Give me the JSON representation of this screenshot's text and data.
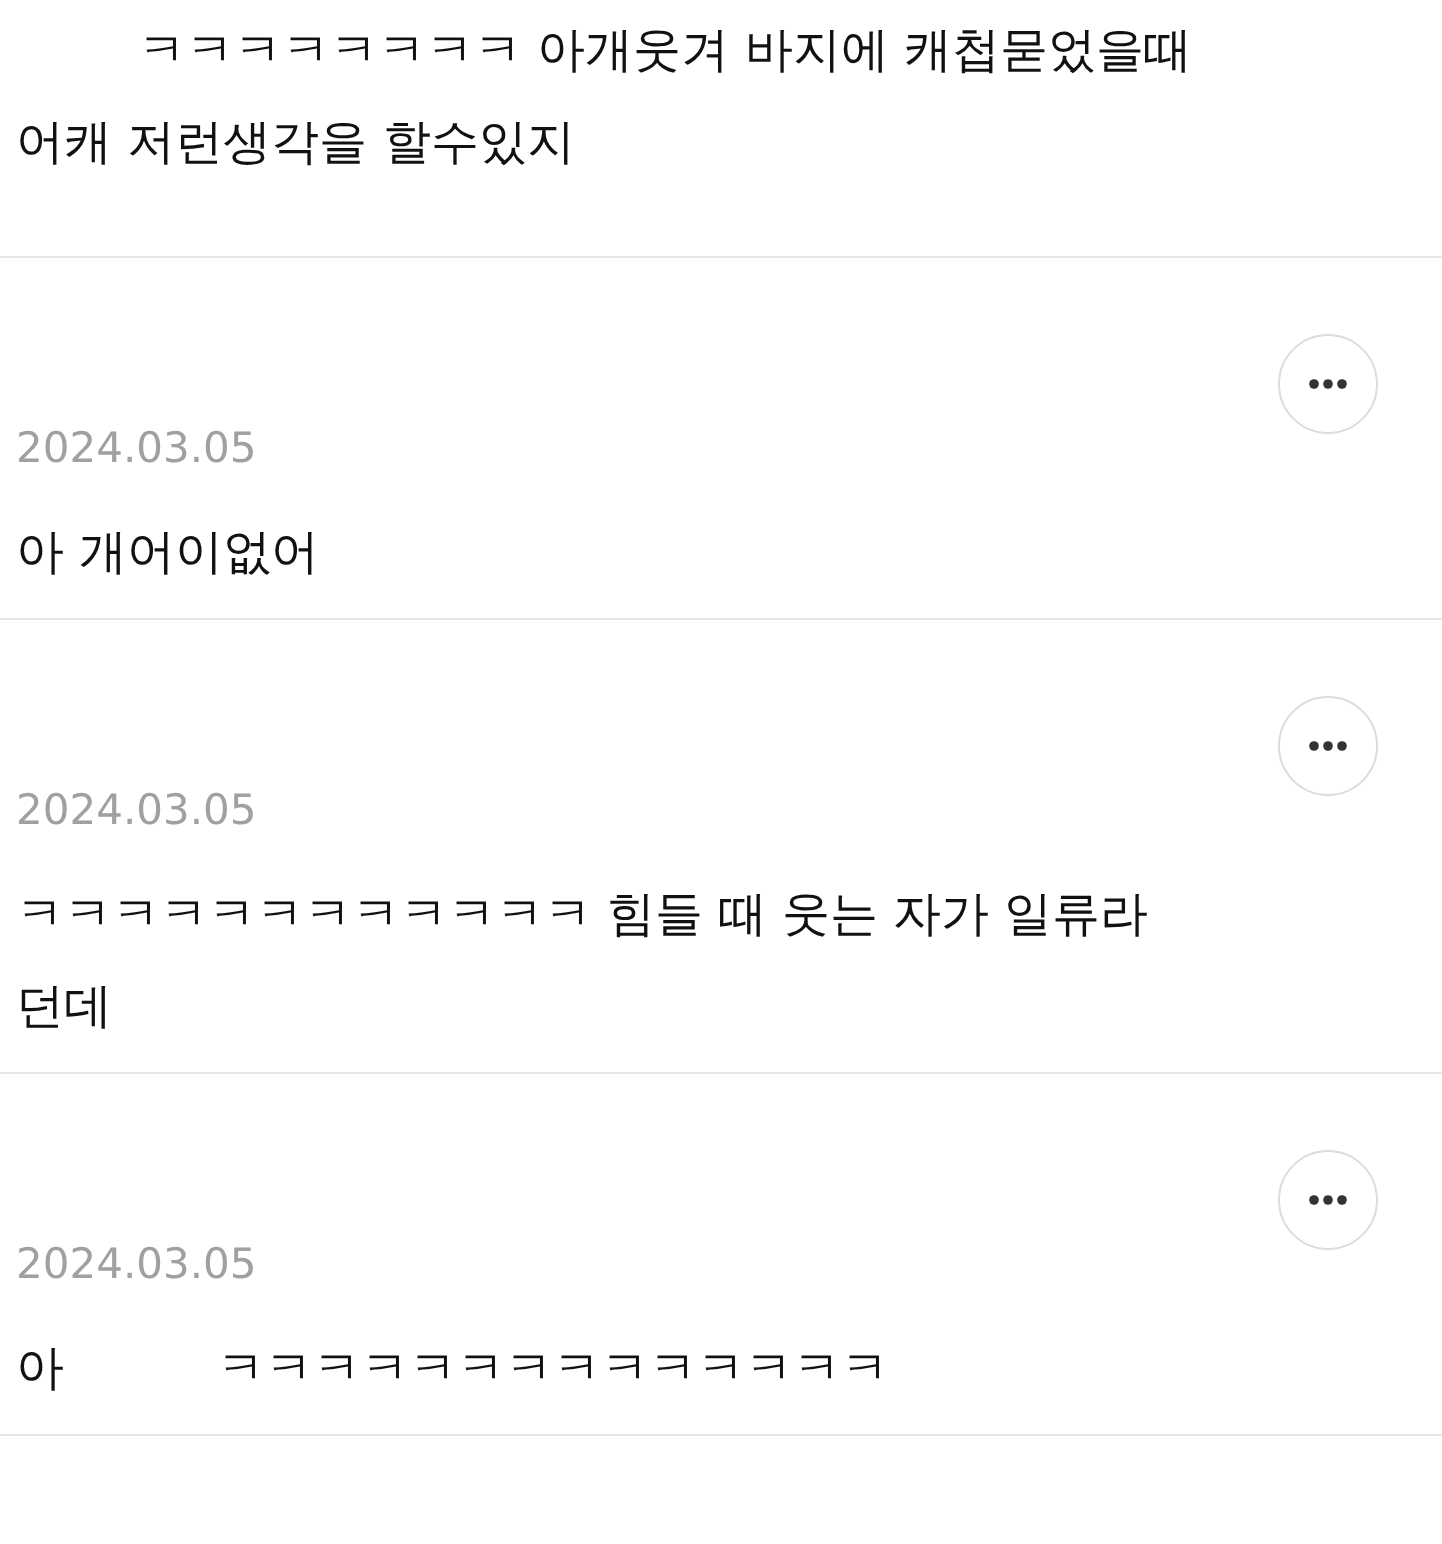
{
  "comments": [
    {
      "lines": [
        "        ㅋㅋㅋㅋㅋㅋㅋㅋ 아개웃겨 바지에 캐첩묻었을때",
        "어캐 저런생각을 할수있지"
      ]
    },
    {
      "date": "2024.03.05",
      "lines": [
        "아 개어이없어"
      ]
    },
    {
      "date": "2024.03.05",
      "lines": [
        "ㅋㅋㅋㅋㅋㅋㅋㅋㅋㅋㅋㅋ 힘들 때 웃는 자가 일류라",
        "던데"
      ]
    },
    {
      "date": "2024.03.05",
      "lines": [
        "아          ㅋㅋㅋㅋㅋㅋㅋㅋㅋㅋㅋㅋㅋㅋ"
      ]
    }
  ]
}
